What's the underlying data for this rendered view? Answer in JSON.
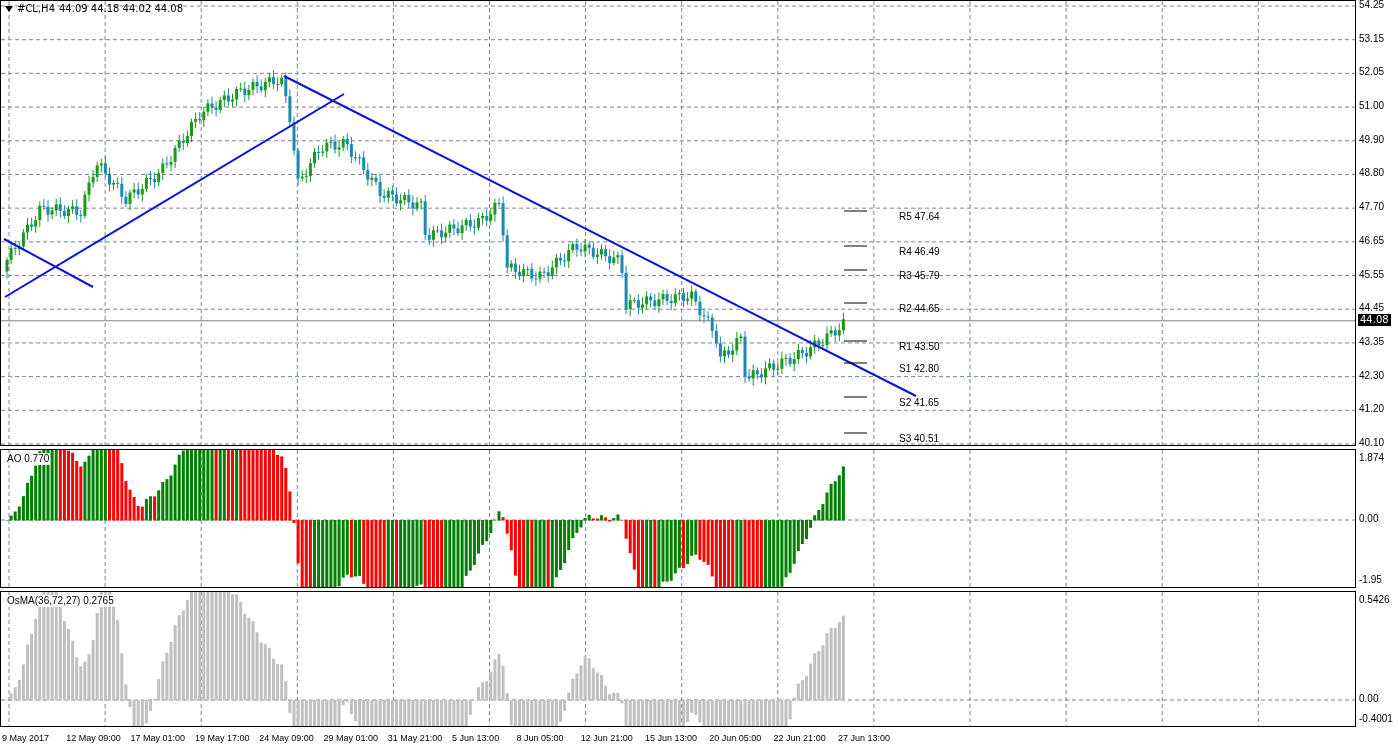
{
  "chart": {
    "symbol": "#CL,H4",
    "quote": "44.09 44.18 44.02 44.08",
    "price_ticks": [
      "54.25",
      "53.15",
      "52.05",
      "51.00",
      "49.90",
      "48.80",
      "47.70",
      "46.65",
      "45.55",
      "44.45",
      "43.35",
      "42.30",
      "41.20",
      "40.10"
    ],
    "current_price": "44.08",
    "pivots": [
      {
        "label": "R5 47.64"
      },
      {
        "label": "R4 46.49"
      },
      {
        "label": "R3 45.79"
      },
      {
        "label": "R2 44.65"
      },
      {
        "label": "R1 43.50"
      },
      {
        "label": "S1 42.80"
      },
      {
        "label": "S2 41.65"
      },
      {
        "label": "S3 40.51"
      }
    ]
  },
  "indicators": [
    {
      "kind": "ao",
      "label": "AO 0.770",
      "ticks": [
        "1.874",
        "0.00",
        "-1.95"
      ]
    },
    {
      "kind": "osma",
      "label": "OsMA(36,72,27) 0.2765",
      "ticks": [
        "0.5426",
        "0.00",
        "-0.4001"
      ]
    }
  ],
  "time_axis": [
    "9 May 2017",
    "12 May 09:00",
    "17 May 01:00",
    "19 May 17:00",
    "24 May 09:00",
    "29 May 01:00",
    "31 May 21:00",
    "5 Jun 13:00",
    "8 Jun 05:00",
    "12 Jun 21:00",
    "15 Jun 13:00",
    "20 Jun 05:00",
    "22 Jun 21:00",
    "27 Jun 13:00"
  ]
}
